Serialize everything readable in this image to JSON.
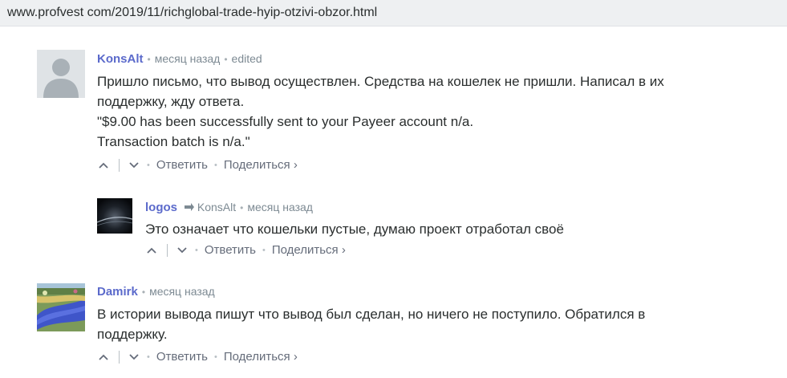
{
  "browser": {
    "url": "www.profvest com/2019/11/richglobal-trade-hyip-otzivi-obzor.html"
  },
  "comments": [
    {
      "author": "KonsAlt",
      "time": "месяц назад",
      "edited": "edited",
      "lines": [
        "Пришло письмо, что вывод осуществлен. Средства на кошелек не пришли. Написал в их",
        "поддержку, жду ответа.",
        "\"$9.00 has been successfully sent to your Payeer account n/a.",
        "Transaction batch is n/a.\""
      ],
      "reply_label": "Ответить",
      "share_label": "Поделиться ›"
    },
    {
      "author": "logos",
      "reply_to": "KonsAlt",
      "time": "месяц назад",
      "lines": [
        "Это означает что кошельки пустые, думаю проект отработал своё"
      ],
      "reply_label": "Ответить",
      "share_label": "Поделиться ›"
    },
    {
      "author": "Damirk",
      "time": "месяц назад",
      "lines": [
        "В истории вывода пишут что вывод был сделан, но ничего не поступило. Обратился в",
        "поддержку."
      ],
      "reply_label": "Ответить",
      "share_label": "Поделиться ›"
    }
  ],
  "colors": {
    "author": "#5b6acb",
    "meta": "#7d8a93",
    "text": "#2a2e2e"
  },
  "icons": [
    "default-avatar-icon",
    "reply-arrow-icon",
    "upvote-icon",
    "downvote-icon"
  ]
}
